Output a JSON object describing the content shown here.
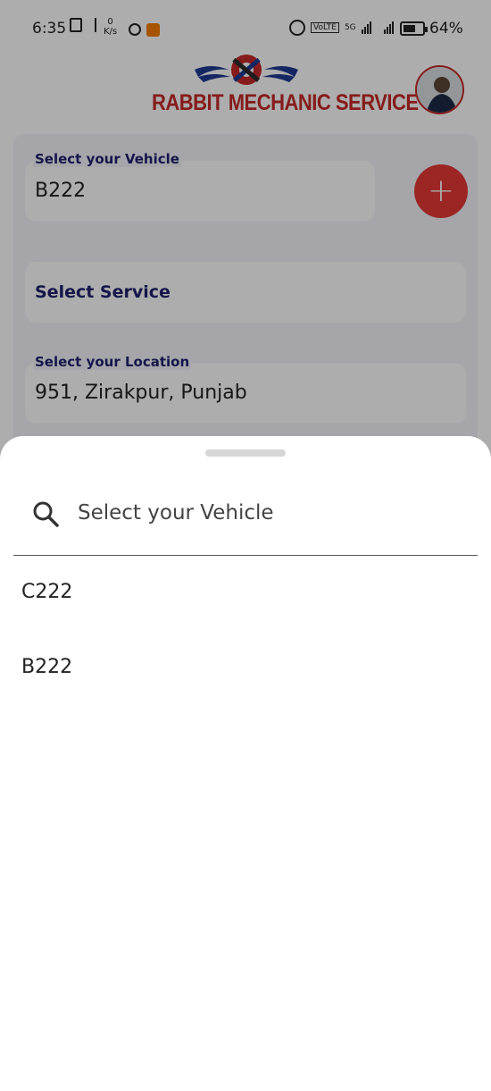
{
  "status_bar": {
    "time": "6:35",
    "netspeed_value": "0",
    "netspeed_unit": "K/s",
    "volte_label": "VoLTE",
    "network_label": "5G",
    "battery_percent": 64,
    "battery_label": "64%"
  },
  "header": {
    "logo_text": "RABBIT MECHANIC SERVICE"
  },
  "form": {
    "vehicle_label": "Select your Vehicle",
    "vehicle_value": "B222",
    "service_label": "Select Service",
    "location_label": "Select your Location",
    "location_value": "951, Zirakpur, Punjab",
    "add_button": "+"
  },
  "sheet": {
    "search_placeholder": "Select your Vehicle",
    "items": [
      {
        "label": "C222"
      },
      {
        "label": "B222"
      }
    ]
  },
  "colors": {
    "brand_red": "#c62828",
    "fab_red": "#e53935",
    "label_navy": "#1f1f6e"
  }
}
